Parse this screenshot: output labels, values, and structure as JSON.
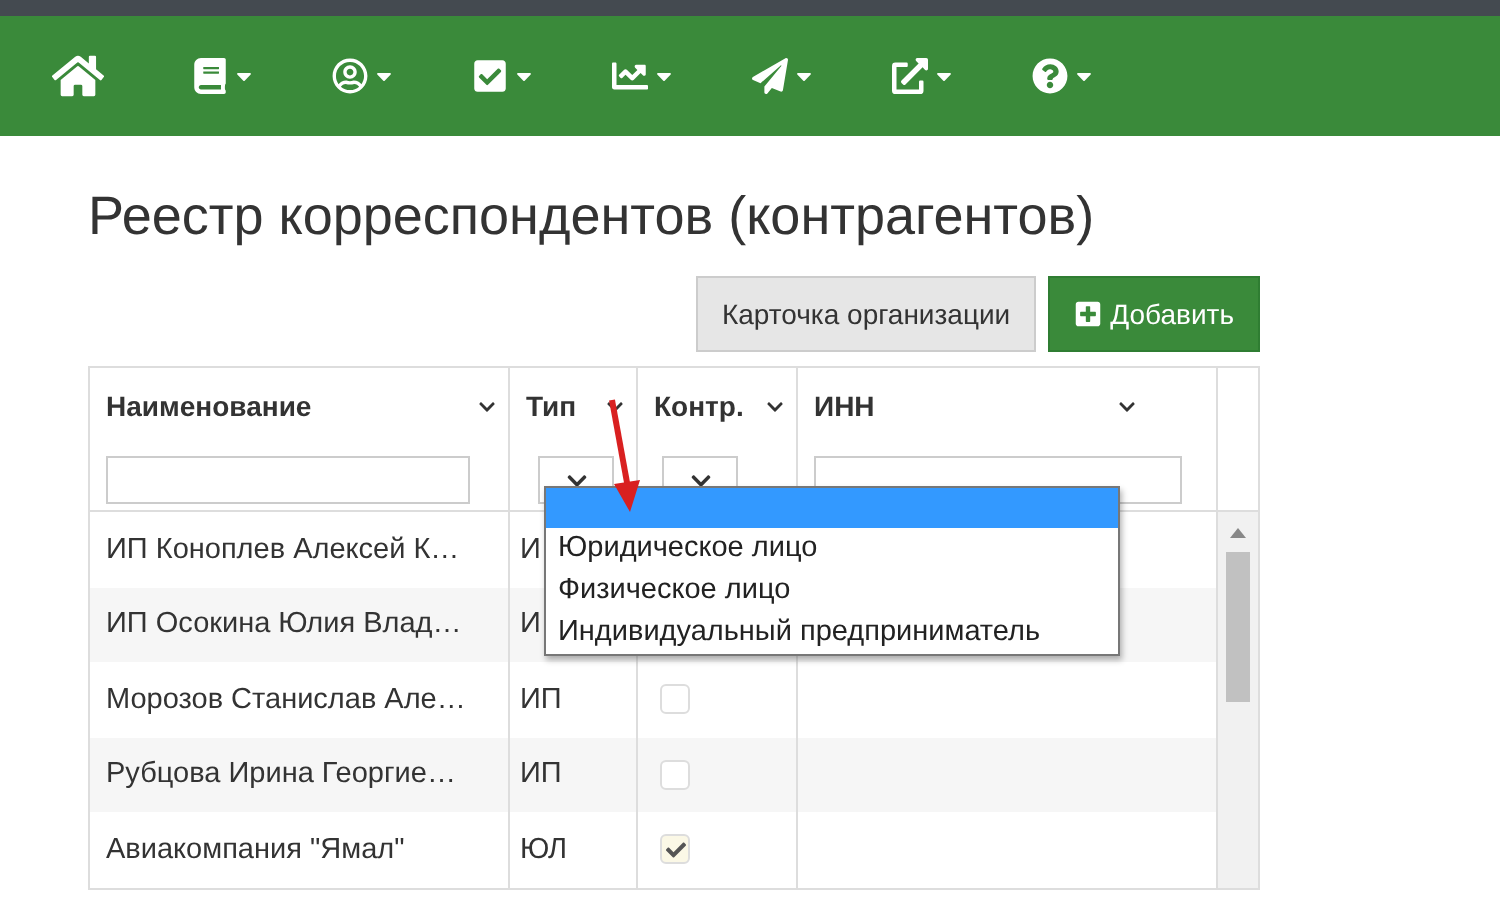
{
  "nav": [
    {
      "kind": "home",
      "menu": false
    },
    {
      "kind": "book",
      "menu": true
    },
    {
      "kind": "user",
      "menu": true
    },
    {
      "kind": "check",
      "menu": true
    },
    {
      "kind": "chart",
      "menu": true
    },
    {
      "kind": "send",
      "menu": true
    },
    {
      "kind": "external",
      "menu": true
    },
    {
      "kind": "help",
      "menu": true
    }
  ],
  "title": "Реестр корреспондентов (контрагентов)",
  "buttons": [
    {
      "label": "Карточка организации",
      "kind": "secondary"
    },
    {
      "label": "Добавить",
      "kind": "primary"
    }
  ],
  "table": {
    "columns": [
      {
        "label": "Наименование",
        "kind": "text"
      },
      {
        "label": "Тип",
        "kind": "select"
      },
      {
        "label": "Контр.",
        "kind": "select"
      },
      {
        "label": "ИНН",
        "kind": "text"
      }
    ],
    "rows": [
      {
        "name": "ИП Коноплев Алексей К…",
        "type": "И"
      },
      {
        "name": "ИП Осокина Юлия Влад…",
        "type": "И"
      },
      {
        "name": "Морозов Станислав Але…",
        "type": "ИП",
        "checked": false
      },
      {
        "name": "Рубцова Ирина Георгие…",
        "type": "ИП",
        "checked": false
      },
      {
        "name": "Авиакомпания \"Ямал\"",
        "type": "ЮЛ",
        "checked": true
      }
    ]
  },
  "dropdown": {
    "options": [
      {
        "selected": true
      },
      {
        "label": "Юридическое лицо",
        "selected": false
      },
      {
        "label": "Физическое лицо",
        "selected": false
      },
      {
        "label": "Индивидуальный предприниматель",
        "selected": false
      }
    ]
  }
}
